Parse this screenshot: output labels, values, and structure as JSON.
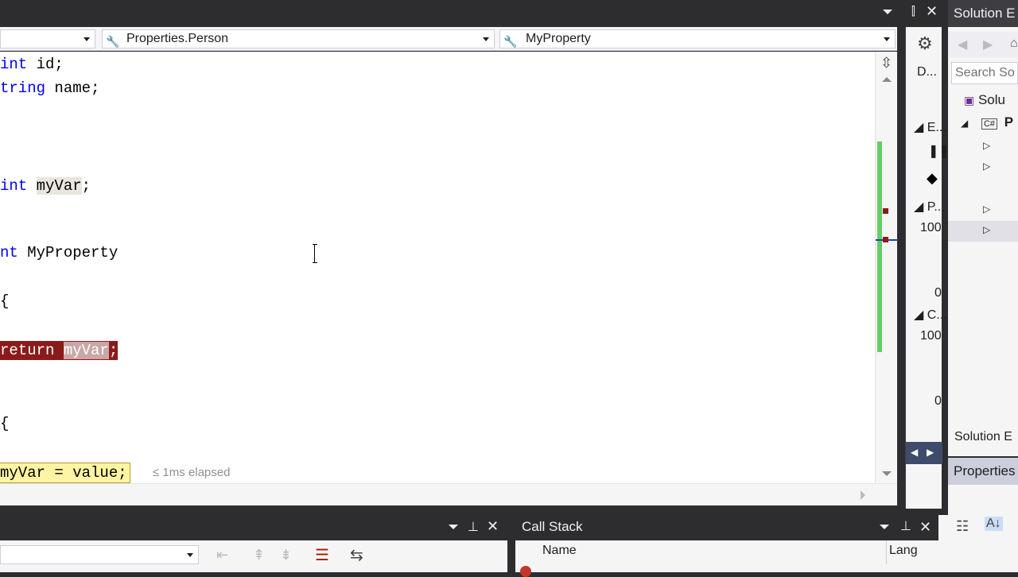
{
  "nav": {
    "type_dropdown": "Properties.Person",
    "member_dropdown": "MyProperty"
  },
  "code": {
    "line1_kw": "int",
    "line1_rest": " id;",
    "line2_kw": "tring",
    "line2_rest": " name;",
    "line3_kw": "int",
    "line3_ref": "myVar",
    "line3_end": ";",
    "line4_kw": "nt",
    "line4_rest": " MyProperty",
    "brace1": "{",
    "line5_kw": "return",
    "line5_ref": "myVar",
    "line5_end": ";",
    "brace2": "{",
    "line6_ref": "myVar",
    "line6_rest": " = value;",
    "elapsed": "≤ 1ms elapsed"
  },
  "diagnostics": {
    "header": "D...",
    "events": "E...",
    "process_memory": "P...",
    "process_value": "100",
    "cpu": "C...",
    "cpu_value": "100",
    "zero1": "0",
    "zero2": "0"
  },
  "solution_explorer": {
    "title": "Solution E",
    "search_placeholder": "Search So",
    "row_solution": "Solu",
    "tab_label": "Solution E"
  },
  "properties": {
    "title": "Properties"
  },
  "call_stack": {
    "title": "Call Stack",
    "col_name": "Name",
    "col_lang": "Lang"
  },
  "colors": {
    "breakpoint": "#8b1a1a",
    "current_line": "#fff4a3",
    "keyword": "#0000ff",
    "change_bar": "#66cc66"
  }
}
